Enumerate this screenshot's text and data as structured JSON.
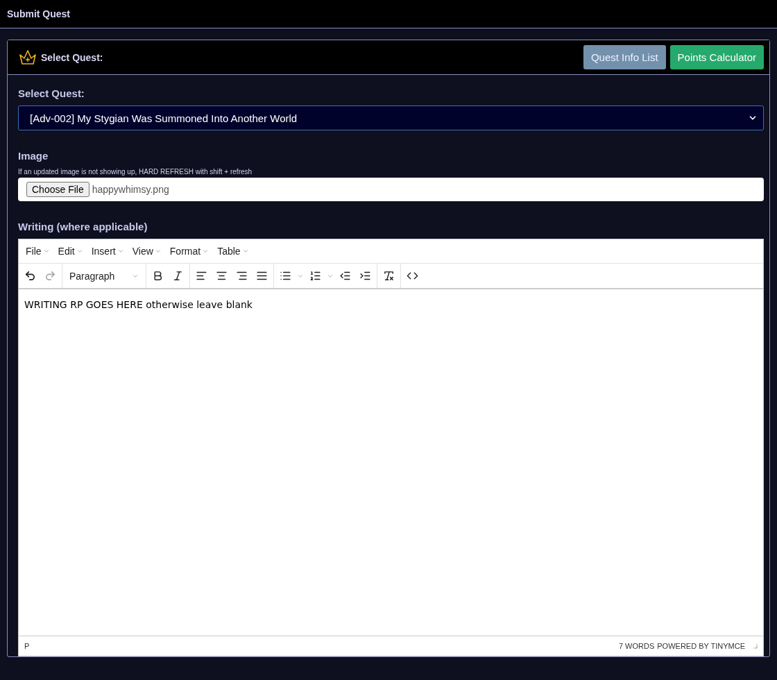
{
  "top_bar": {
    "title": "Submit Quest"
  },
  "card": {
    "title": "Select Quest:",
    "buttons": [
      {
        "label": "Quest Info List",
        "disabled": true,
        "kind": "info"
      },
      {
        "label": "Points Calculator",
        "disabled": false,
        "kind": "success"
      }
    ]
  },
  "quest_field": {
    "label": "Select Quest:",
    "value": "[Adv-002] My Stygian Was Summoned Into Another World"
  },
  "image_field": {
    "label": "Image",
    "hint": "If an updated image is not showing up, HARD REFRESH with shift + refresh",
    "button": "Choose File",
    "file_name": "happywhimsy.png"
  },
  "writing": {
    "label": "Writing (where applicable)",
    "menu": [
      "File",
      "Edit",
      "Insert",
      "View",
      "Format",
      "Table"
    ],
    "history": [
      {
        "kind": "undo",
        "disabled": false
      },
      {
        "kind": "redo",
        "disabled": true
      }
    ],
    "block_format": "Paragraph",
    "content": "WRITING RP GOES HERE otherwise leave blank",
    "status_path": "P",
    "word_count": "7 WORDS",
    "branding": "POWERED BY TINYMCE"
  }
}
